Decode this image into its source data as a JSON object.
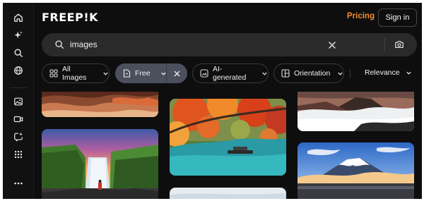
{
  "brand": {
    "logo_text": "FREEP!K"
  },
  "header": {
    "pricing_label": "Pricing",
    "signin_label": "Sign in"
  },
  "search": {
    "query": "images"
  },
  "filters": {
    "all_images": "All Images",
    "free": "Free",
    "ai_generated": "AI-generated",
    "orientation": "Orientation",
    "sort": "Relevance"
  },
  "sidebar": {
    "icons": [
      "home-icon",
      "sparkle-icon",
      "search-icon",
      "globe-icon",
      "image-icon",
      "video-icon",
      "chat-sparkle-icon",
      "grid-apps-icon",
      "more-icon"
    ]
  },
  "gallery": {
    "items": [
      "rock-canyon-image",
      "waterfall-image",
      "autumn-lake-boat-image",
      "volcano-clouds-image",
      "mount-fuji-image",
      "snow-image"
    ]
  },
  "colors": {
    "accent": "#f28c28",
    "background": "#0e0e0e",
    "chip_active": "#4c4f5c"
  }
}
